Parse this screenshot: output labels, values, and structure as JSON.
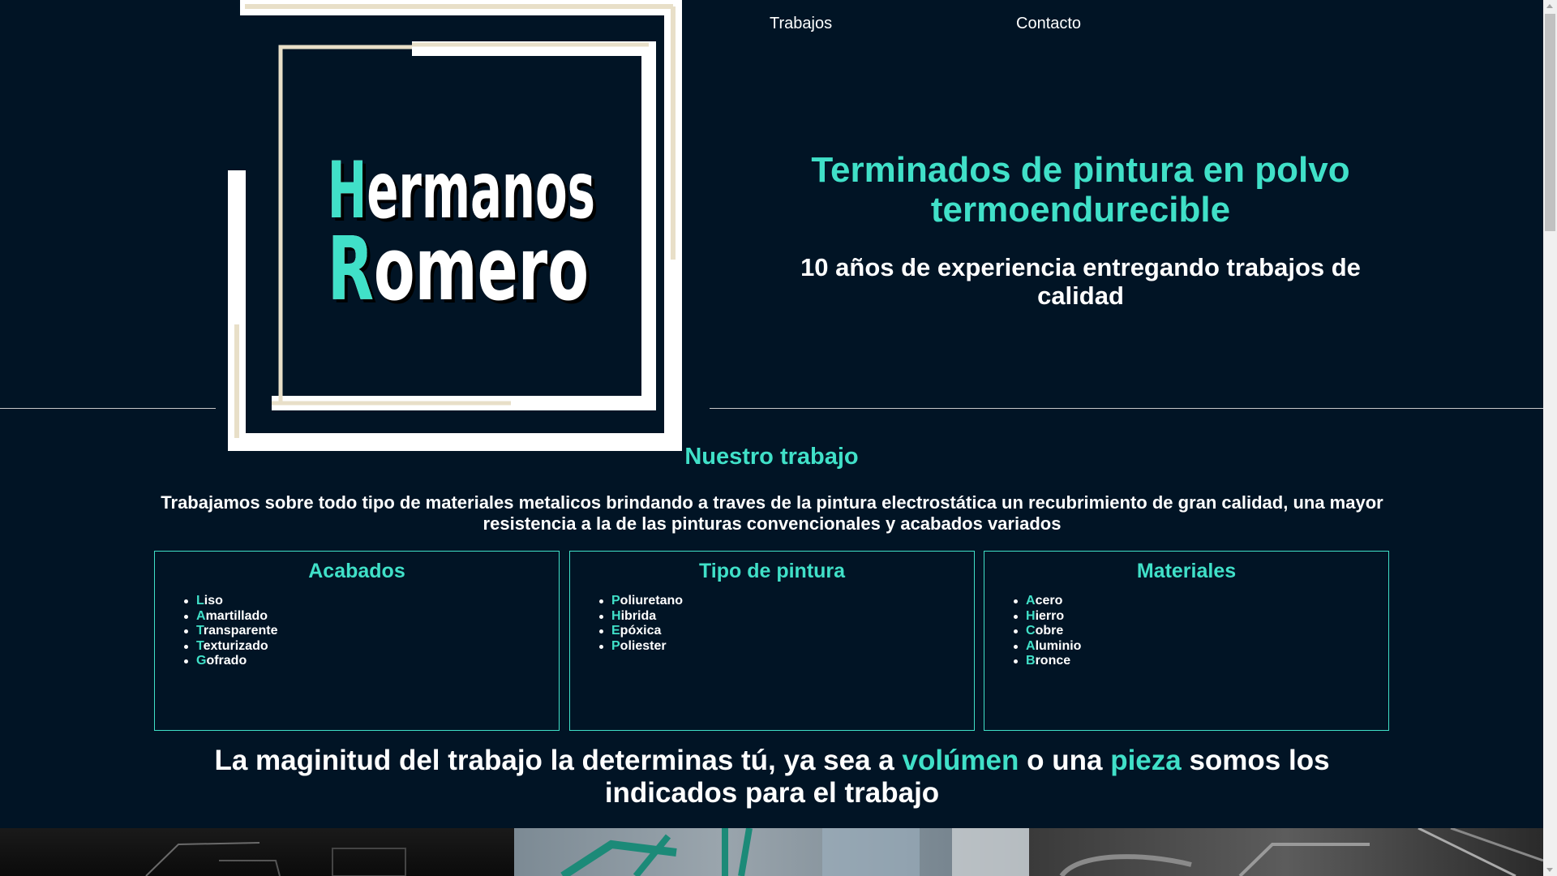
{
  "nav": {
    "items": [
      {
        "label": "Trabajos"
      },
      {
        "label": "Contacto"
      }
    ]
  },
  "logo": {
    "line1": "Hermanos",
    "line2": "Romero"
  },
  "hero": {
    "title": "Terminados de pintura en polvo termoendurecible",
    "subtitle": "10 años de experiencia entregando trabajos de calidad"
  },
  "section": {
    "title": "Nuestro trabajo",
    "description": "Trabajamos sobre todo tipo de materiales metalicos brindando a traves de la pintura electrostática un recubrimiento de gran calidad, una mayor resistencia a la de las pinturas convencionales y acabados variados"
  },
  "cards": [
    {
      "title": "Acabados",
      "items": [
        {
          "first": "L",
          "rest": "iso"
        },
        {
          "first": "A",
          "rest": "martillado"
        },
        {
          "first": "T",
          "rest": "ransparente"
        },
        {
          "first": "T",
          "rest": "exturizado"
        },
        {
          "first": "G",
          "rest": "ofrado"
        }
      ]
    },
    {
      "title": "Tipo de pintura",
      "items": [
        {
          "first": "P",
          "rest": "oliuretano"
        },
        {
          "first": "H",
          "rest": "ibrida"
        },
        {
          "first": "E",
          "rest": "póxica"
        },
        {
          "first": "P",
          "rest": "oliester"
        }
      ]
    },
    {
      "title": "Materiales",
      "items": [
        {
          "first": "A",
          "rest": "cero"
        },
        {
          "first": "H",
          "rest": "ierro"
        },
        {
          "first": "C",
          "rest": "obre"
        },
        {
          "first": "A",
          "rest": "luminio"
        },
        {
          "first": "B",
          "rest": "ronce"
        }
      ]
    }
  ],
  "tagline": {
    "part1": "La maginitud del trabajo la determinas tú, ya sea a ",
    "hl1": "volúmen",
    "part2": " o una ",
    "hl2": "pieza",
    "part3": " somos los indicados para el trabajo"
  },
  "colors": {
    "background": "#011425",
    "accent": "#40e0c8",
    "frame": "#ffffff",
    "frame_gold": "#e8dfc8"
  }
}
